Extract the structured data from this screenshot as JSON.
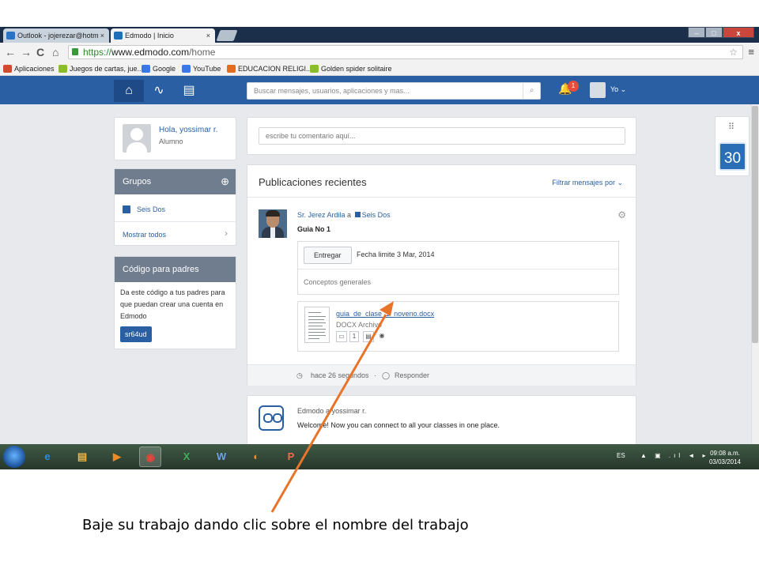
{
  "browser": {
    "tabs": [
      {
        "label": "Outlook - jojerezar@hotm",
        "close": "×"
      },
      {
        "label": "Edmodo | Inicio",
        "close": "×"
      }
    ],
    "window_controls": {
      "minimize": "–",
      "maximize": "□",
      "close": "x"
    },
    "nav": {
      "back": "←",
      "forward": "→",
      "reload": "C",
      "home": "⌂"
    },
    "url": {
      "scheme": "https://",
      "host": "www.edmodo.com",
      "path": "/home"
    },
    "bookmark_star": "☆",
    "menu": "≡",
    "bookmarks": [
      {
        "label": "Aplicaciones",
        "color": "#d44a2e"
      },
      {
        "label": "Juegos de cartas, jue...",
        "color": "#8bbd2a"
      },
      {
        "label": "Google",
        "color": "#3b78e7"
      },
      {
        "label": "YouTube",
        "color": "#3b78e7"
      },
      {
        "label": "EDUCACION RELIGI...",
        "color": "#e56b1f"
      },
      {
        "label": "Golden spider solitaire",
        "color": "#8bbd2a"
      }
    ]
  },
  "edmodo": {
    "nav": {
      "home_icon": "⌂",
      "activity_icon": "∿",
      "calendar_icon": "▤",
      "search_placeholder": "Buscar mensajes, usuarios, aplicaciones y mas...",
      "search_icon": "⌕",
      "bell_icon": "🔔",
      "notification_count": "1",
      "me_label": "Yo ⌄"
    },
    "profile": {
      "greeting": "Hola, yossimar r.",
      "role": "Alumno"
    },
    "groups": {
      "title": "Grupos",
      "add_icon": "⊕",
      "items": [
        {
          "label": "Seis Dos"
        }
      ],
      "show_all": "Mostrar todos",
      "chevron": "›"
    },
    "parent_code": {
      "title": "Código para padres",
      "body": "Da este código a tus padres para que puedan crear una cuenta en Edmodo",
      "code": "sr64ud"
    },
    "comment": {
      "placeholder": "escribe tu comentario aquí..."
    },
    "feed": {
      "title": "Publicaciones recientes",
      "filter": "Filtrar mensajes por ⌄",
      "post": {
        "author": "Sr. Jerez Ardila",
        "to_word": "a",
        "group": "Seis Dos",
        "gear": "⚙",
        "title": "Guia No 1",
        "turn_in": "Entregar",
        "due": "Fecha limite 3 Mar, 2014",
        "description": "Conceptos generales",
        "file": {
          "name": "guia_de_clase_1_noveno.docx",
          "type": "DOCX Archivo",
          "count": "1"
        },
        "time": "hace 26 segundos",
        "separator": "·",
        "reply": "Responder"
      },
      "welcome": {
        "from": "Edmodo",
        "to_word": "a",
        "to": "yossimar r.",
        "text": "Welcome! Now you can connect to all your classes in one place."
      }
    },
    "widgets": {
      "apps_icon": "⠿",
      "calendar_day": "30"
    }
  },
  "taskbar": {
    "apps": [
      {
        "name": "internet-explorer",
        "glyph": "e",
        "color": "#2b8fe0"
      },
      {
        "name": "file-explorer",
        "glyph": "▤",
        "color": "#e8b54a"
      },
      {
        "name": "media-player",
        "glyph": "▶",
        "color": "#f08a24"
      },
      {
        "name": "chrome",
        "glyph": "◉",
        "color": "#e0483a"
      },
      {
        "name": "excel",
        "glyph": "X",
        "color": "#1f7a3a"
      },
      {
        "name": "word",
        "glyph": "W",
        "color": "#2a5fa8"
      },
      {
        "name": "firefox",
        "glyph": "◐",
        "color": "#e86a1a"
      },
      {
        "name": "powerpoint",
        "glyph": "P",
        "color": "#d0462b"
      }
    ],
    "lang": "ES",
    "tray_icons": "▲ ▣ .ıl ◄ ▸",
    "time": "09:08 a.m.",
    "date": "03/03/2014"
  },
  "annotation": {
    "caption": "Baje su trabajo dando clic sobre el nombre del trabajo",
    "arrow_color": "#e8742a"
  }
}
